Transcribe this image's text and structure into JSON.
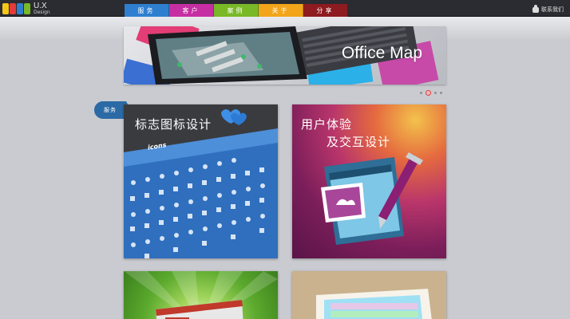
{
  "header": {
    "logo": {
      "title": "U.X",
      "subtitle": "Design"
    },
    "nav": [
      {
        "label": "服务",
        "color": "#2f7fd0"
      },
      {
        "label": "客户",
        "color": "#c62fa3"
      },
      {
        "label": "案例",
        "color": "#79b927"
      },
      {
        "label": "关于",
        "color": "#f2a51a"
      },
      {
        "label": "分享",
        "color": "#8e1b1f"
      }
    ],
    "contact_label": "联系我们",
    "contact_icon": "contact-icon"
  },
  "banner": {
    "title": "Office Map",
    "slide_count": 4,
    "active_slide": 2
  },
  "section": {
    "tag": "服务"
  },
  "cards": {
    "icon_design": {
      "title": "标志图标设计",
      "sheet_label": "icons"
    },
    "ux_design": {
      "title_line1": "用户体验",
      "title_line2": "及交互设计"
    }
  }
}
